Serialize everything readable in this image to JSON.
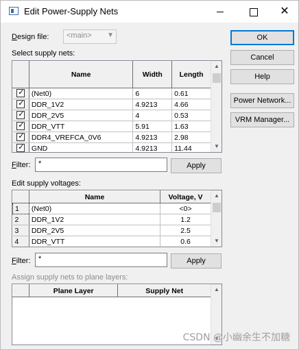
{
  "window": {
    "title": "Edit Power-Supply Nets",
    "minimize_icon": "minimize-icon",
    "maximize_icon": "maximize-icon",
    "close_icon": "close-icon",
    "close_glyph": "✕"
  },
  "design_file": {
    "label_prefix": "D",
    "label_rest": "esign file:",
    "value": "<main>"
  },
  "select_nets": {
    "label": "Select supply nets:",
    "columns": [
      "Name",
      "Width",
      "Length"
    ],
    "rows": [
      {
        "checked": true,
        "name": "(Net0)",
        "width": "6",
        "length": "0.61"
      },
      {
        "checked": true,
        "name": "DDR_1V2",
        "width": "4.9213",
        "length": "4.66"
      },
      {
        "checked": true,
        "name": "DDR_2V5",
        "width": "4",
        "length": "0.53"
      },
      {
        "checked": true,
        "name": "DDR_VTT",
        "width": "5.91",
        "length": "1.63"
      },
      {
        "checked": true,
        "name": "DDR4_VREFCA_0V6",
        "width": "4.9213",
        "length": "2.98"
      },
      {
        "checked": true,
        "name": "GND",
        "width": "4.9213",
        "length": "11.44"
      }
    ]
  },
  "filter1": {
    "label_prefix": "F",
    "label_rest": "ilter:",
    "value": "*",
    "apply": "Apply"
  },
  "voltages": {
    "label": "Edit supply voltages:",
    "columns": [
      "Name",
      "Voltage, V"
    ],
    "rows": [
      {
        "index": "1",
        "name": "(Net0)",
        "voltage": "<0>"
      },
      {
        "index": "2",
        "name": "DDR_1V2",
        "voltage": "1.2"
      },
      {
        "index": "3",
        "name": "DDR_2V5",
        "voltage": "2.5"
      },
      {
        "index": "4",
        "name": "DDR_VTT",
        "voltage": "0.6"
      }
    ]
  },
  "filter2": {
    "label_prefix": "F",
    "label_rest": "ilter:",
    "value": "*",
    "apply": "Apply"
  },
  "plane": {
    "label": "Assign supply nets to plane layers:",
    "columns": [
      "Plane Layer",
      "Supply Net"
    ]
  },
  "buttons": {
    "ok": "OK",
    "cancel": "Cancel",
    "help": "Help",
    "power_network": "Power Network...",
    "vrm_manager": "VRM Manager..."
  },
  "watermark": "CSDN @小幽余生不加糖"
}
